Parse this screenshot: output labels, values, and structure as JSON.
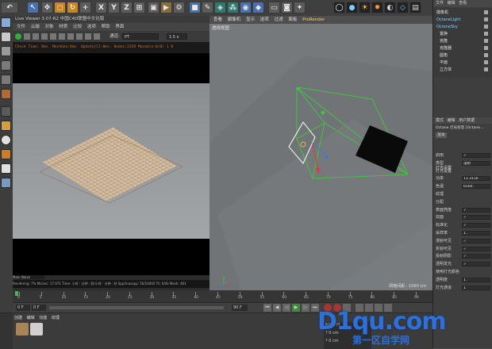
{
  "toolbar": {
    "tools": [
      "undo",
      "select",
      "move",
      "scale",
      "rotate",
      "x",
      "y",
      "z",
      "coords",
      "render-view",
      "render",
      "render-settings",
      "cube",
      "pen",
      "subdivide",
      "array",
      "sky",
      "deformer",
      "floor",
      "camera",
      "light",
      "octane-a",
      "octane-b",
      "octane-c",
      "octane-d",
      "octane-e",
      "octane-f"
    ],
    "axis_x": "X",
    "axis_y": "Y",
    "axis_z": "Z"
  },
  "live_viewer": {
    "title": "Live Viewer 3.07-R2 中国C4D联盟中文化版",
    "menu": [
      "文件",
      "云端",
      "对象",
      "材质",
      "比较",
      "选项",
      "帮助",
      "界面"
    ],
    "channel_label": "通道:",
    "channel_value": "PT",
    "zoom_value": "1.5 x",
    "status": "Check Time: 0ms. MeshGen:0ms. Update[C]:0ms. Nodes:2329 Movable:0(0) 1 0",
    "bottom_tabs": "Main  Noise",
    "info_line": "Rendering: 7%   Ms/sec: 17.971   Time: 小时 : 分钟 : 秒/小时 : 分钟 : 秒   Spp/maxspp: 56/16000   Tri: 0/4k   Mesh: 401"
  },
  "viewport": {
    "menu": [
      "查看",
      "摄像机",
      "显示",
      "选项",
      "过滤",
      "面板",
      "ProRender"
    ],
    "label": "透视视图",
    "footer": "网格间距 : 1000 cm"
  },
  "object_manager": {
    "menu": [
      "文件",
      "编辑",
      "查看"
    ],
    "objects": [
      {
        "name": "摄像机",
        "color": "#e0e0e0"
      },
      {
        "name": "OctaneLight",
        "color": "#7fd0ff"
      },
      {
        "name": "OctaneSky",
        "color": "#7fd0ff"
      },
      {
        "name": "置换",
        "color": "#e0e0e0"
      },
      {
        "name": "克隆",
        "color": "#e0e0e0"
      },
      {
        "name": "克隆器",
        "color": "#e0e0e0"
      },
      {
        "name": "圆角",
        "color": "#e0e0e0"
      },
      {
        "name": "平面",
        "color": "#e0e0e0"
      },
      {
        "name": "立方体",
        "color": "#e0e0e0"
      }
    ]
  },
  "attributes": {
    "menu": [
      "模式",
      "编辑",
      "用户数据"
    ],
    "object_title": "Octane 灯光标签 [Octane...",
    "tabs": [
      "基本",
      "灯光设置"
    ],
    "rows": [
      {
        "label": "启用",
        "value": "✓"
      },
      {
        "label": "类型",
        "value": "漫射"
      },
      {
        "label": "灯光设置",
        "value": ""
      },
      {
        "label": "功率",
        "value": "11.3116"
      },
      {
        "label": "色温",
        "value": "6500."
      },
      {
        "label": "纹理",
        "value": ""
      },
      {
        "label": "分配",
        "value": ""
      },
      {
        "label": "表面亮度",
        "value": "✓"
      },
      {
        "label": "双面",
        "value": "✓"
      },
      {
        "label": "标准化",
        "value": "✓"
      },
      {
        "label": "采样率",
        "value": "1."
      },
      {
        "label": "漫射可见",
        "value": "✓"
      },
      {
        "label": "折射可见",
        "value": "✓"
      },
      {
        "label": "投射阴影",
        "value": "✓"
      },
      {
        "label": "透明发光",
        "value": "✓"
      },
      {
        "label": "使用灯光颜色",
        "value": ""
      },
      {
        "label": "透明度",
        "value": "1."
      },
      {
        "label": "灯光通道",
        "value": "1"
      }
    ]
  },
  "timeline": {
    "ticks": [
      "0",
      "5",
      "10",
      "15",
      "20",
      "25",
      "30",
      "35",
      "40",
      "45",
      "50",
      "55",
      "60",
      "65",
      "70",
      "75",
      "80",
      "85",
      "90"
    ],
    "current_frame": "0 F",
    "start_frame": "0 F",
    "end_frame": "90 F"
  },
  "material_manager": {
    "menu": [
      "创建",
      "编辑",
      "功能",
      "纹理"
    ]
  },
  "coords_panel": {
    "values": [
      "6?1.???",
      "? 0 cm",
      "? 0 cm"
    ]
  },
  "watermark": {
    "text": "D1qu.com",
    "subtext": "第一区自学网"
  },
  "colors": {
    "accent_orange": "#e8a640",
    "octane_cyan": "#7fd0ff",
    "gizmo_green": "#3ec83e",
    "watermark_blue": "#2f6fd8"
  }
}
